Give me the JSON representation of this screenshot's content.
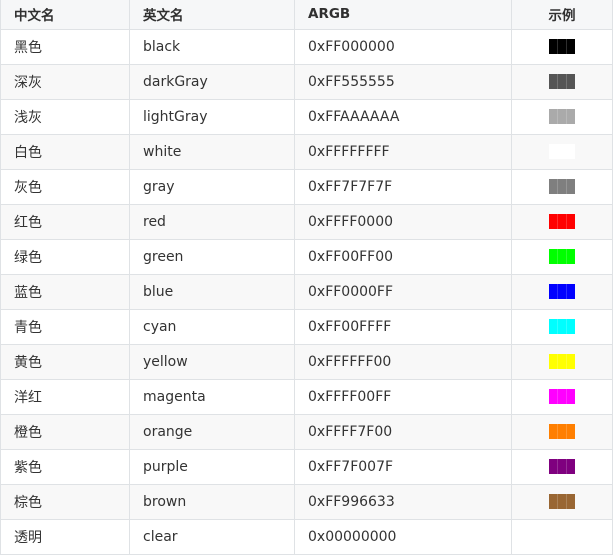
{
  "table": {
    "headers": [
      "中文名",
      "英文名",
      "ARGB",
      "示例"
    ],
    "rows": [
      {
        "zh": "黑色",
        "en": "black",
        "argb": "0xFF000000",
        "swatch": "#000000"
      },
      {
        "zh": "深灰",
        "en": "darkGray",
        "argb": "0xFF555555",
        "swatch": "#555555"
      },
      {
        "zh": "浅灰",
        "en": "lightGray",
        "argb": "0xFFAAAAAA",
        "swatch": "#AAAAAA"
      },
      {
        "zh": "白色",
        "en": "white",
        "argb": "0xFFFFFFFF",
        "swatch": "#FFFFFF"
      },
      {
        "zh": "灰色",
        "en": "gray",
        "argb": "0xFF7F7F7F",
        "swatch": "#7F7F7F"
      },
      {
        "zh": "红色",
        "en": "red",
        "argb": "0xFFFF0000",
        "swatch": "#FF0000"
      },
      {
        "zh": "绿色",
        "en": "green",
        "argb": "0xFF00FF00",
        "swatch": "#00FF00"
      },
      {
        "zh": "蓝色",
        "en": "blue",
        "argb": "0xFF0000FF",
        "swatch": "#0000FF"
      },
      {
        "zh": "青色",
        "en": "cyan",
        "argb": "0xFF00FFFF",
        "swatch": "#00FFFF"
      },
      {
        "zh": "黄色",
        "en": "yellow",
        "argb": "0xFFFFFF00",
        "swatch": "#FFFF00"
      },
      {
        "zh": "洋红",
        "en": "magenta",
        "argb": "0xFFFF00FF",
        "swatch": "#FF00FF"
      },
      {
        "zh": "橙色",
        "en": "orange",
        "argb": "0xFFFF7F00",
        "swatch": "#FF7F00"
      },
      {
        "zh": "紫色",
        "en": "purple",
        "argb": "0xFF7F007F",
        "swatch": "#7F007F"
      },
      {
        "zh": "棕色",
        "en": "brown",
        "argb": "0xFF996633",
        "swatch": "#996633"
      },
      {
        "zh": "透明",
        "en": "clear",
        "argb": "0x00000000",
        "swatch": null
      }
    ]
  }
}
